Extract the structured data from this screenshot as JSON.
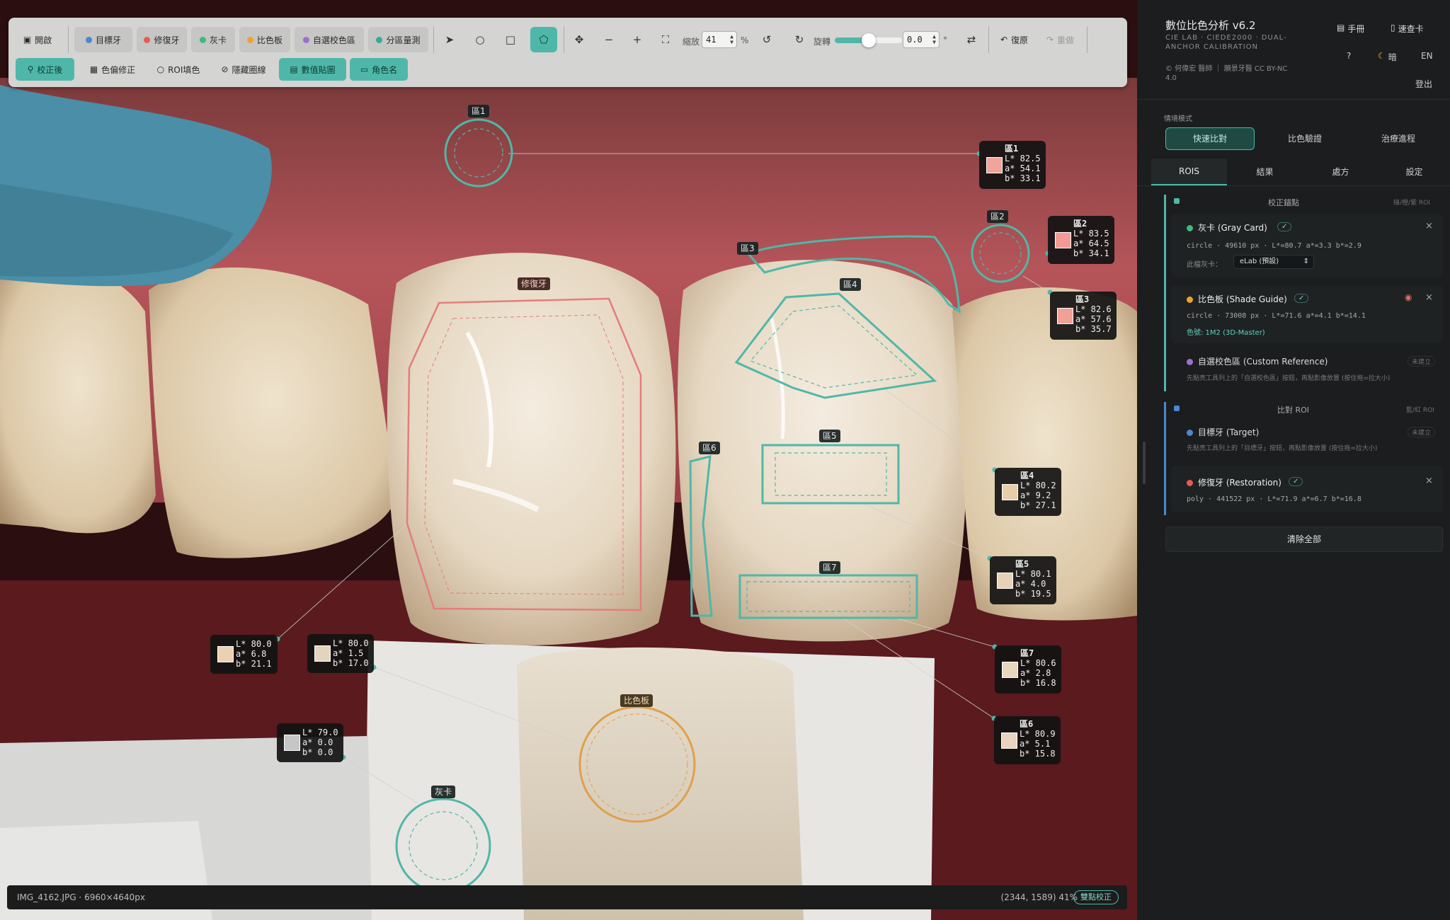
{
  "toolbar": {
    "open": "開啟",
    "target_tooth": "目標牙",
    "restoration": "修復牙",
    "gray_card": "灰卡",
    "shade_guide": "比色板",
    "custom_ref": "自選校色區",
    "zone_measure": "分區量測",
    "zoom_label": "縮放",
    "zoom_value": "41",
    "zoom_unit": "%",
    "rotate_label": "旋轉",
    "rotate_value": "0.0",
    "rotate_unit": "°",
    "reset": "復原",
    "redo": "重做",
    "corrected": "校正後",
    "color_deviation": "色偏修正",
    "roi_fill": "ROI填色",
    "hide_outline": "隱藏圈線",
    "value_labels": "數值貼圖",
    "role_names": "角色名"
  },
  "status": {
    "file": "IMG_4162.JPG · 6960×4640px",
    "coords": "(2344, 1589) 41%",
    "badge": "雙點校正"
  },
  "colors": {
    "teal": "#4fb7a9",
    "red_outline": "#e47d7d",
    "orange_outline": "#e0a04a",
    "target_blue": "#4a88d0",
    "restoration_red": "#e85a4f",
    "gray_green": "#3fb97a",
    "shade_orange": "#f0a030",
    "custom_purple": "#9a6fd0"
  },
  "labels": {
    "zone1": "區1",
    "zone2": "區2",
    "zone3": "區3",
    "zone4": "區4",
    "zone5": "區5",
    "zone6": "區6",
    "zone7": "區7",
    "restoration": "修復牙",
    "shade_guide": "比色板",
    "gray_card": "灰卡"
  },
  "cards": {
    "z1": {
      "title": "區1",
      "text": "L* 82.5\na* 54.1\nb* 33.1",
      "swatch": "#f2a39a"
    },
    "z2": {
      "title": "區2",
      "text": "L* 83.5\na* 64.5\nb* 34.1",
      "swatch": "#f49a96"
    },
    "z3": {
      "title": "區3",
      "text": "L* 82.6\na* 57.6\nb* 35.7",
      "swatch": "#f3a096"
    },
    "z4": {
      "title": "區4",
      "text": "L* 80.2\na* 9.2\nb* 27.1",
      "swatch": "#e9cda8"
    },
    "z5": {
      "title": "區5",
      "text": "L* 80.1\na* 4.0\nb* 19.5",
      "swatch": "#e8d2b6"
    },
    "z7": {
      "title": "區7",
      "text": "L* 80.6\na* 2.8\nb* 16.8",
      "swatch": "#e8d6bd"
    },
    "z6": {
      "title": "區6",
      "text": "L* 80.9\na* 5.1\nb* 15.8",
      "swatch": "#ead4bf"
    },
    "rest": {
      "text": "L* 80.0\na* 6.8\nb* 21.1",
      "swatch": "#ebd0b3"
    },
    "shade": {
      "text": "L* 80.0\na* 1.5\nb* 17.0",
      "swatch": "#e3d5bd"
    },
    "gray": {
      "text": "L* 79.0\na* 0.0\nb* 0.0",
      "swatch": "#c6c6c6"
    }
  },
  "sidebar": {
    "title": "數位比色分析 v6.2",
    "subtitle": "CIE LAB · CIEDE2000 · DUAL-ANCHOR CALIBRATION",
    "credit": "© 何偉宏 醫師 ｜ 願景牙醫 CC BY-NC 4.0",
    "manual": "手冊",
    "quick_card": "速查卡",
    "help": "?",
    "dark": "暗",
    "lang": "EN",
    "logout": "登出",
    "mode_label": "情境模式",
    "modes": [
      "快速比對",
      "比色驗證",
      "治療進程"
    ],
    "tabs": [
      "ROIS",
      "結果",
      "處方",
      "設定"
    ],
    "cal_section": "校正錨點",
    "cal_hint": "綠/橙/紫 ROI",
    "gray_title": "灰卡 (Gray Card)",
    "gray_info": "circle · 49610 px · L*=80.7 a*=3.3 b*=2.9",
    "gray_select_label": "此檔灰卡：",
    "gray_select_value": "eLab (預設)",
    "shade_title": "比色板 (Shade Guide)",
    "shade_info": "circle · 73008 px · L*=71.6 a*=4.1 b*=14.1",
    "shade_code": "色號: 1M2 (3D-Master)",
    "custom_title": "自選校色區 (Custom Reference)",
    "custom_status": "未建立",
    "custom_hint": "先點亮工具列上的「自選校色區」按鈕，再點影像放置 (按住拖=拉大小)",
    "cmp_section": "比對 ROI",
    "cmp_hint": "藍/紅 ROI",
    "target_title": "目標牙 (Target)",
    "target_status": "未建立",
    "target_hint": "先點亮工具列上的「目標牙」按鈕，再點影像放置 (按住拖=拉大小)",
    "rest_title": "修復牙 (Restoration)",
    "rest_info": "poly · 441522 px · L*=71.9 a*=6.7 b*=16.8",
    "clear_all": "清除全部",
    "check": "✓",
    "close": "×"
  }
}
